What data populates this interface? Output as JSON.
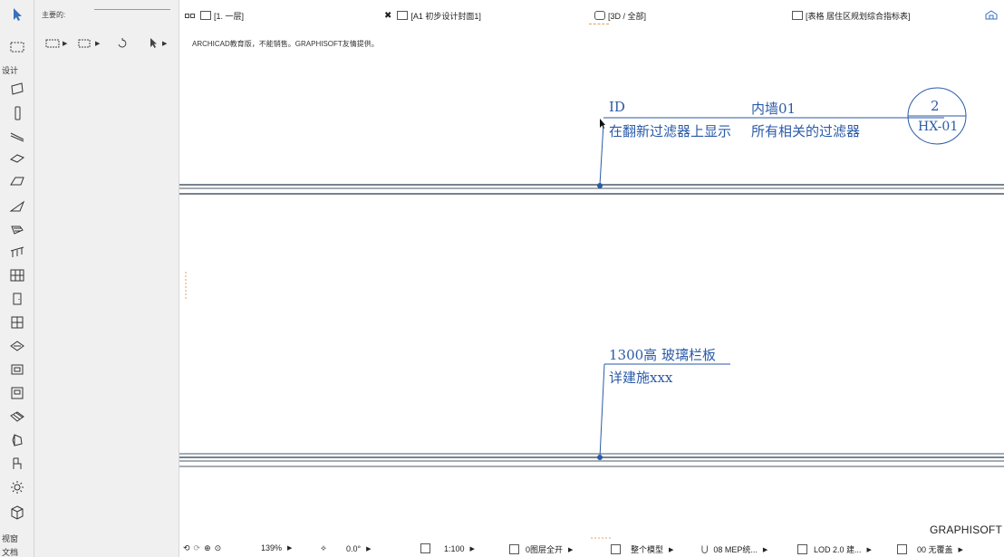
{
  "toolbox": {
    "section_design": "设计",
    "section_view": "视窗",
    "section_doc": "文档",
    "tools": [
      "arrow-select-icon",
      "marquee-icon",
      "wall-icon",
      "column-icon",
      "beam-icon",
      "slab-icon",
      "roof-icon",
      "shell-icon",
      "stair-icon",
      "railing-icon",
      "curtain-wall-icon",
      "door-icon",
      "window-icon",
      "skylight-icon",
      "opening-icon",
      "zone-icon",
      "mesh-icon",
      "morph-icon",
      "object-icon",
      "lamp-icon",
      "mep-icon"
    ]
  },
  "infobox": {
    "label": "主要的:"
  },
  "tabs": [
    {
      "label": "[1. 一层]",
      "icon": "floorplan-icon",
      "active": true
    },
    {
      "label": "[A1 初步设计封面1]",
      "icon": "layout-icon"
    },
    {
      "label": "[3D / 全部]",
      "icon": "3d-icon"
    },
    {
      "label": "[表格 居住区规划综合指标表]",
      "icon": "schedule-icon"
    }
  ],
  "canvas": {
    "watermark": "ARCHICAD教育版，不能销售。GRAPHISOFT友情提供。",
    "brand": "GRAPHISOFT",
    "annotation1": {
      "id": "ID",
      "name": "内墙01",
      "filter_note": "在翻新过滤器上显示",
      "filter_value": "所有相关的过滤器",
      "marker_number": "2",
      "marker_code": "HX-01"
    },
    "annotation2": {
      "title": "1300高 玻璃栏板",
      "detail": "详建施xxx"
    }
  },
  "statusbar": {
    "zoom": "139%",
    "angle": "0.0°",
    "scale": "1:100",
    "layers": "0图层全开",
    "model": "整个模型",
    "mep": "08 MEP统...",
    "lod": "LOD 2.0 建...",
    "override": "00 无覆盖"
  },
  "colors": {
    "annotation": "#2a5aa8",
    "wall": "#4a5a6a"
  }
}
